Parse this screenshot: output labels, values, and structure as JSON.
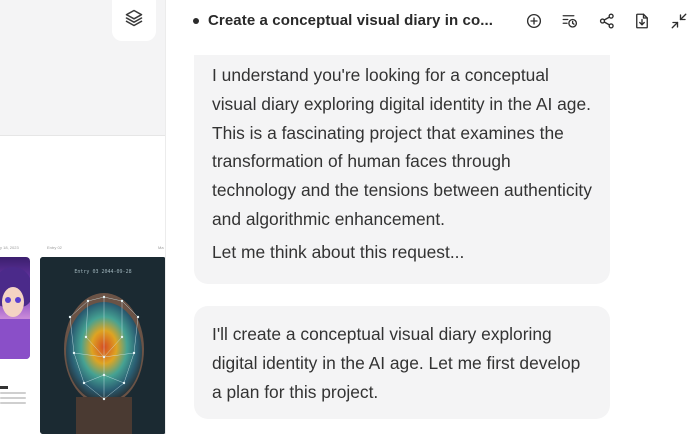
{
  "header": {
    "title": "Create a conceptual visual diary in co...",
    "icons": [
      "new-message-icon",
      "history-icon",
      "share-icon",
      "export-icon",
      "collapse-icon"
    ]
  },
  "preview": {
    "labels": [
      "y 18, 2023",
      "Entry 02",
      "Ma"
    ],
    "face_card_label": "Entry 03 2044-09-28"
  },
  "messages": [
    {
      "role": "assistant",
      "paragraphs": [
        "I understand you're looking for a conceptual visual diary exploring digital identity in the AI age. This is a fascinating project that examines the transformation of human faces through technology and the tensions between authenticity and algorithmic enhancement.",
        "Let me think about this request..."
      ]
    },
    {
      "role": "assistant",
      "paragraphs": [
        "I'll create a conceptual visual diary exploring digital identity in the AI age. Let me first develop a plan for this project."
      ]
    }
  ],
  "colors": {
    "panel_bg": "#f4f4f5",
    "bubble_bg": "#f4f4f5",
    "text": "#333333",
    "title": "#2a2a2a"
  }
}
